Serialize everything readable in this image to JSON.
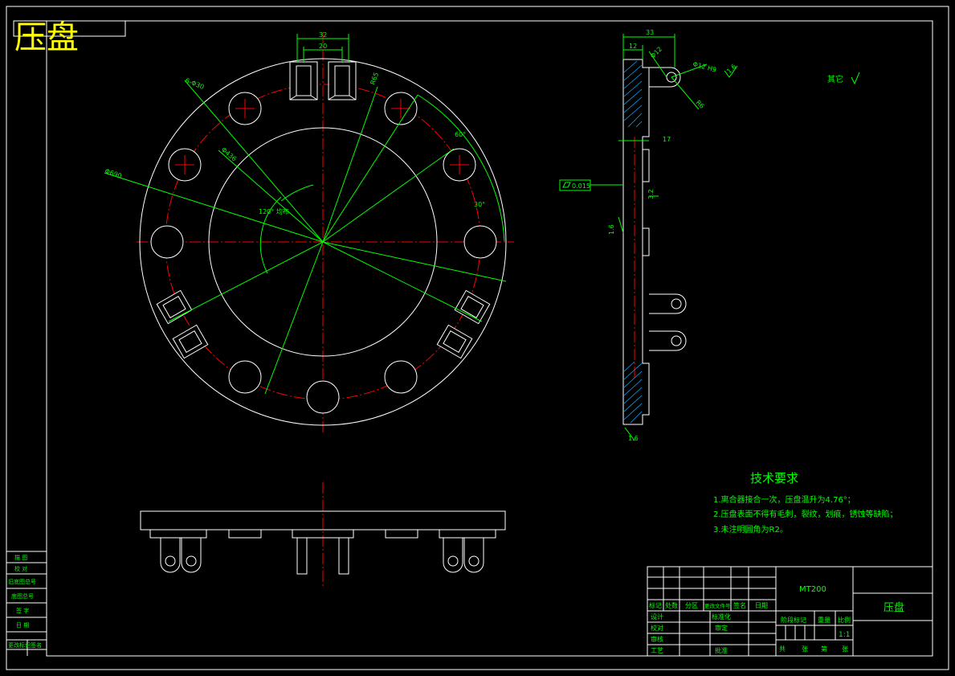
{
  "title": "压盘",
  "colors": {
    "line": "#ffffff",
    "dim": "#00ff00",
    "center": "#ff0000",
    "title": "#ffff00",
    "hatch": "#00aaff"
  },
  "front_view": {
    "dims": {
      "slot_outer": "32",
      "slot_inner": "20",
      "hole_dia": "6-Φ30",
      "pcd_label": "Φ450",
      "outer_dia": "Φ690",
      "inner_dia": "Φ436",
      "r_label": "R65",
      "angle_60": "60°",
      "angle_30": "30°",
      "angle_120": "120° 均布"
    }
  },
  "side_view": {
    "dims": {
      "width_33": "33",
      "width_12": "12",
      "dim_17": "17",
      "dim_2": "2",
      "pin": "Φ12",
      "hole_h": "Φ12 H9",
      "r6": "R6",
      "rough_16": "1.6",
      "rough_32": "3.2",
      "rough_25": "1.6",
      "rough_bottom": "1.6",
      "flatness": "0.015"
    },
    "other_roughness": "其它"
  },
  "tech_requirements": {
    "heading": "技术要求",
    "items": [
      "1.离合器接合一次，压盘温升为4.76°；",
      "2.压盘表面不得有毛刺，裂纹，划痕，锈蚀等缺陷；",
      "3.未注明圆角为R2。"
    ]
  },
  "left_strip": [
    "描 图",
    "校 对",
    "旧底图总号",
    "底图总号",
    "签 字",
    "日 期",
    "更改标记",
    "签名"
  ],
  "title_block": {
    "code": "MT200",
    "part_name": "压盘",
    "header_row": [
      "标记",
      "处数",
      "分区",
      "更改文件号",
      "签名",
      "日期"
    ],
    "rows": [
      [
        "设计",
        "",
        "标准化"
      ],
      [
        "校对",
        "",
        "审定"
      ],
      [
        "审核",
        "",
        ""
      ],
      [
        "工艺",
        "",
        "批准"
      ]
    ],
    "stage_labels": [
      "阶段标记",
      "重量",
      "比例"
    ],
    "scale": "1:1",
    "sheet_labels": [
      "共",
      "张",
      "第",
      "张"
    ]
  }
}
